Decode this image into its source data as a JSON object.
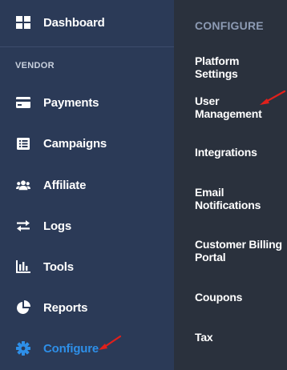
{
  "sidebar": {
    "dashboard": {
      "label": "Dashboard",
      "icon": "dashboard-grid-icon"
    },
    "section_label": "VENDOR",
    "items": [
      {
        "label": "Payments",
        "icon": "credit-card-icon"
      },
      {
        "label": "Campaigns",
        "icon": "list-icon"
      },
      {
        "label": "Affiliate",
        "icon": "users-icon"
      },
      {
        "label": "Logs",
        "icon": "exchange-arrows-icon"
      },
      {
        "label": "Tools",
        "icon": "bar-chart-icon"
      },
      {
        "label": "Reports",
        "icon": "pie-chart-icon"
      },
      {
        "label": "Configure",
        "icon": "gear-icon",
        "active": true
      }
    ],
    "active_color": "#2e8fe8"
  },
  "submenu": {
    "title": "CONFIGURE",
    "items": [
      {
        "label": "Platform Settings"
      },
      {
        "label": "User\nManagement"
      },
      {
        "label": "Integrations"
      },
      {
        "label": "Email\nNotifications"
      },
      {
        "label": "Customer Billing\nPortal"
      },
      {
        "label": "Coupons"
      },
      {
        "label": "Tax"
      }
    ]
  },
  "annotations": {
    "arrow_color": "#e0201b"
  }
}
